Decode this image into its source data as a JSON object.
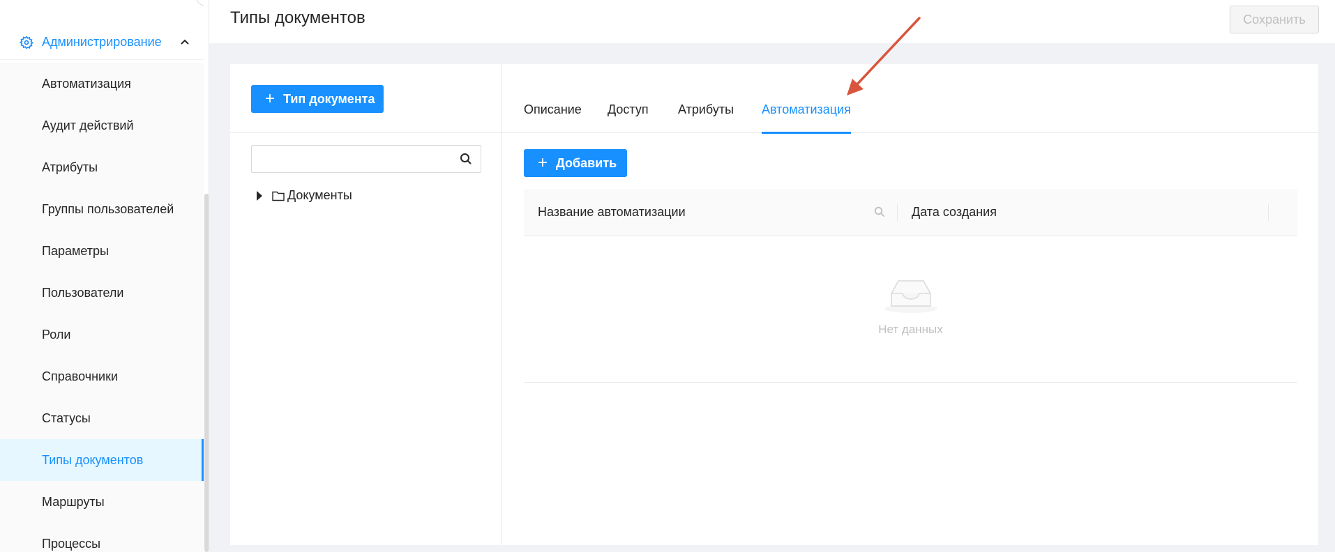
{
  "sidebar": {
    "section_label": "Администрирование",
    "items": [
      {
        "label": "Автоматизация"
      },
      {
        "label": "Аудит действий"
      },
      {
        "label": "Атрибуты"
      },
      {
        "label": "Группы пользователей"
      },
      {
        "label": "Параметры"
      },
      {
        "label": "Пользователи"
      },
      {
        "label": "Роли"
      },
      {
        "label": "Справочники"
      },
      {
        "label": "Статусы"
      },
      {
        "label": "Типы документов"
      },
      {
        "label": "Маршруты"
      },
      {
        "label": "Процессы"
      }
    ],
    "active_item": "Типы документов"
  },
  "header": {
    "title": "Типы документов",
    "save_label": "Сохранить"
  },
  "left_pane": {
    "add_type_label": "Тип документа",
    "search_placeholder": "",
    "tree": [
      {
        "label": "Документы"
      }
    ]
  },
  "right_pane": {
    "tabs": [
      {
        "label": "Описание"
      },
      {
        "label": "Доступ"
      },
      {
        "label": "Атрибуты"
      },
      {
        "label": "Автоматизация"
      }
    ],
    "active_tab": "Автоматизация",
    "add_label": "Добавить",
    "table": {
      "columns": [
        "Название автоматизации",
        "Дата создания"
      ],
      "rows": [],
      "empty_text": "Нет данных"
    }
  },
  "colors": {
    "primary": "#1890ff",
    "annotation_arrow": "#d9553d",
    "active_bg": "#e6f7ff"
  }
}
